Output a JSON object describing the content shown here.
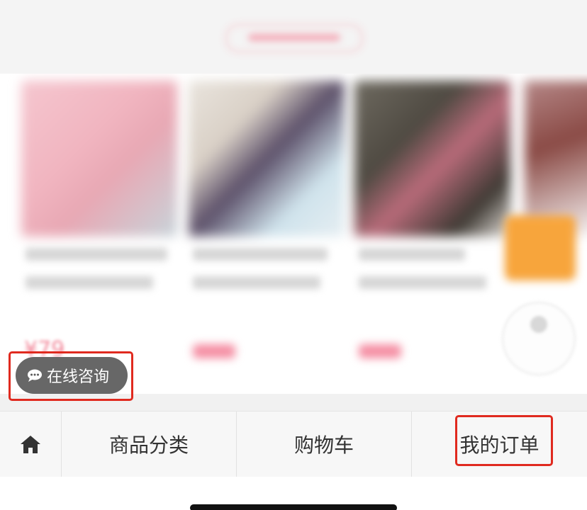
{
  "consult": {
    "label": "在线咨询",
    "icon": "chat-bubble-icon"
  },
  "products": {
    "first_price": "¥79"
  },
  "bottom_nav": {
    "home_icon": "home-icon",
    "items": [
      {
        "label": "商品分类"
      },
      {
        "label": "购物车"
      },
      {
        "label": "我的订单"
      }
    ]
  },
  "colors": {
    "highlight_box": "#e02a1f",
    "consult_bg": "#5a5a5a",
    "price_pink": "#f2889a"
  }
}
